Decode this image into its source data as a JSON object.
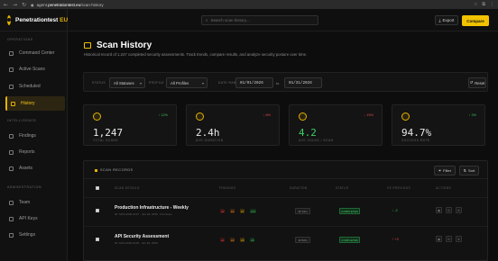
{
  "browser": {
    "url": "agent.penetrationtest.eu/scan-history",
    "url_prefix": "agent.",
    "url_domain": "penetrationtest.eu",
    "url_path": "/scan-history"
  },
  "brand": {
    "name": "Penetrationtest",
    "suffix": "EU"
  },
  "sidebar": {
    "sections": [
      "OPERATIONS",
      "INTELLIGENCE",
      "ADMINISTRATION"
    ],
    "items": [
      {
        "label": "Command Center",
        "icon": "grid-icon"
      },
      {
        "label": "Active Scans",
        "icon": "activity-icon"
      },
      {
        "label": "Scheduled",
        "icon": "calendar-icon"
      },
      {
        "label": "History",
        "icon": "clock-icon",
        "active": true
      },
      {
        "label": "Findings",
        "icon": "bug-icon"
      },
      {
        "label": "Reports",
        "icon": "file-icon"
      },
      {
        "label": "Assets",
        "icon": "server-icon"
      },
      {
        "label": "Team",
        "icon": "users-icon"
      },
      {
        "label": "API Keys",
        "icon": "key-icon"
      },
      {
        "label": "Settings",
        "icon": "gear-icon"
      }
    ]
  },
  "topbar": {
    "search_placeholder": "Search scan history...",
    "export_label": "Export",
    "compare_label": "Compare"
  },
  "page": {
    "title": "Scan History",
    "subtitle": "Historical record of 1,247 completed security assessments. Track trends, compare results, and analyze security posture over time."
  },
  "filters": {
    "status_label": "STATUS",
    "status_value": "All Statuses",
    "profile_label": "PROFILE",
    "profile_value": "All Profiles",
    "date_label": "DATE RANGE",
    "date_from": "01/01/2026",
    "date_to_label": "to",
    "date_to": "01/31/2026",
    "reset_label": "Reset"
  },
  "stats": [
    {
      "value": "1,247",
      "label": "TOTAL SCANS",
      "trend": "↑ 12%",
      "trend_color": "#39c05f",
      "icon": "radar-icon"
    },
    {
      "value": "2.4h",
      "label": "AVG DURATION",
      "trend": "↓ 8%",
      "trend_color": "#e5484d",
      "icon": "clock-icon"
    },
    {
      "value": "4.2",
      "label": "AVG VULNS / SCAN",
      "trend": "↓ 15%",
      "trend_color": "#e5484d",
      "icon": "shield-icon"
    },
    {
      "value": "94.7%",
      "label": "SUCCESS RATE",
      "trend": "↑ 3%",
      "trend_color": "#39c05f",
      "icon": "target-icon"
    }
  ],
  "records": {
    "title": "SCAN RECORDS",
    "filter_label": "Filter",
    "sort_label": "Sort",
    "columns": [
      "SCAN DETAILS",
      "FINDINGS",
      "DURATION",
      "STATUS",
      "VS PREVIOUS",
      "ACTIONS"
    ],
    "rows": [
      {
        "name": "Production Infrastructure - Weekly",
        "meta": "ID: SCN-2026-0147 · Jan 28, 2026 · Full Scan",
        "findings": [
          {
            "text": "2",
            "color": "#e5484d",
            "bg": "#3a1414"
          },
          {
            "text": "4",
            "color": "#f08a24",
            "bg": "#3a2410"
          },
          {
            "text": "7",
            "color": "#e5b200",
            "bg": "#3a300d"
          },
          {
            "text": "12",
            "color": "#39c05f",
            "bg": "#123019"
          }
        ],
        "duration": "3h 24m",
        "status": "COMPLETED",
        "delta": "↓ -2",
        "delta_color": "#39c05f"
      },
      {
        "name": "API Security Assessment",
        "meta": "ID: SCN-2026-0146 · Jan 26, 2026",
        "findings": [
          {
            "text": "1",
            "color": "#e5484d",
            "bg": "#3a1414"
          },
          {
            "text": "3",
            "color": "#f08a24",
            "bg": "#3a2410"
          },
          {
            "text": "5",
            "color": "#e5b200",
            "bg": "#3a300d"
          },
          {
            "text": "8",
            "color": "#39c05f",
            "bg": "#123019"
          }
        ],
        "duration": "1h 52m",
        "status": "COMPLETED",
        "delta": "↑ +3",
        "delta_color": "#e5484d"
      }
    ]
  }
}
